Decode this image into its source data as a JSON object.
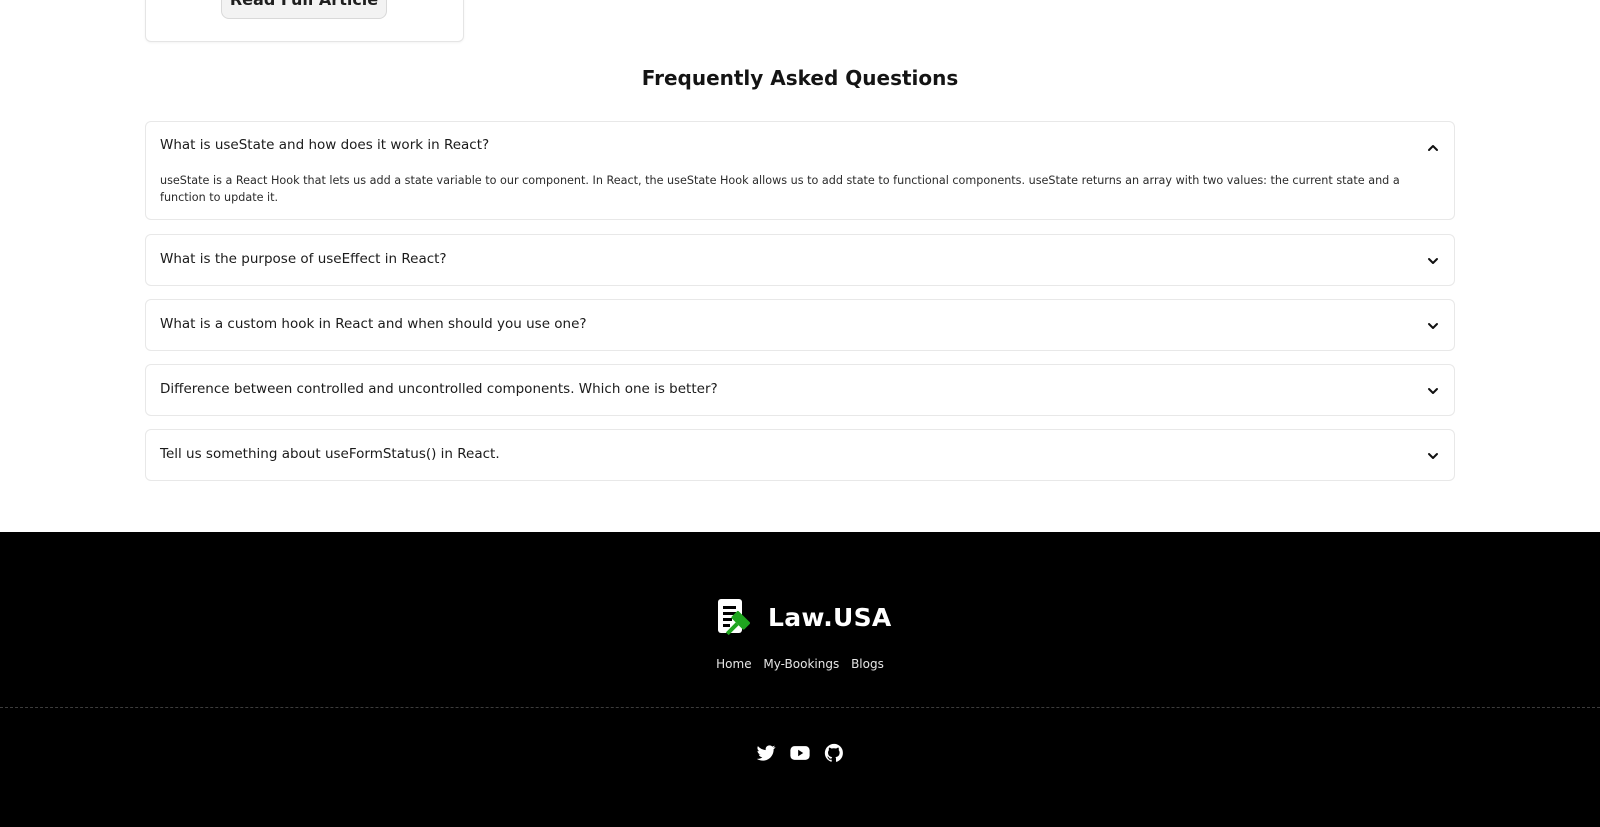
{
  "article": {
    "read_button_label": "Read Full Article"
  },
  "faq": {
    "title": "Frequently Asked Questions",
    "items": [
      {
        "question": "What is useState and how does it work in React?",
        "answer": "useState is a React Hook that lets us add a state variable to our component. In React, the useState Hook allows us to add state to functional components. useState returns an array with two values: the current state and a function to update it.",
        "expanded": true,
        "icon": "chevron-up-icon"
      },
      {
        "question": "What is the purpose of useEffect in React?",
        "expanded": false,
        "icon": "chevron-down-icon"
      },
      {
        "question": "What is a custom hook in React and when should you use one?",
        "expanded": false,
        "icon": "chevron-down-icon"
      },
      {
        "question": "Difference between controlled and uncontrolled components. Which one is better?",
        "expanded": false,
        "icon": "chevron-down-icon"
      },
      {
        "question": "Tell us something about useFormStatus() in React.",
        "expanded": false,
        "icon": "chevron-down-icon"
      }
    ]
  },
  "footer": {
    "brand": "Law.USA",
    "logo_icon": "gavel-document-icon",
    "brand_accent_color": "#1fa51f",
    "background_color": "#000000",
    "nav": [
      "Home",
      "My-Bookings",
      "Blogs"
    ],
    "social_icons": [
      "twitter-icon",
      "youtube-icon",
      "github-icon"
    ]
  }
}
